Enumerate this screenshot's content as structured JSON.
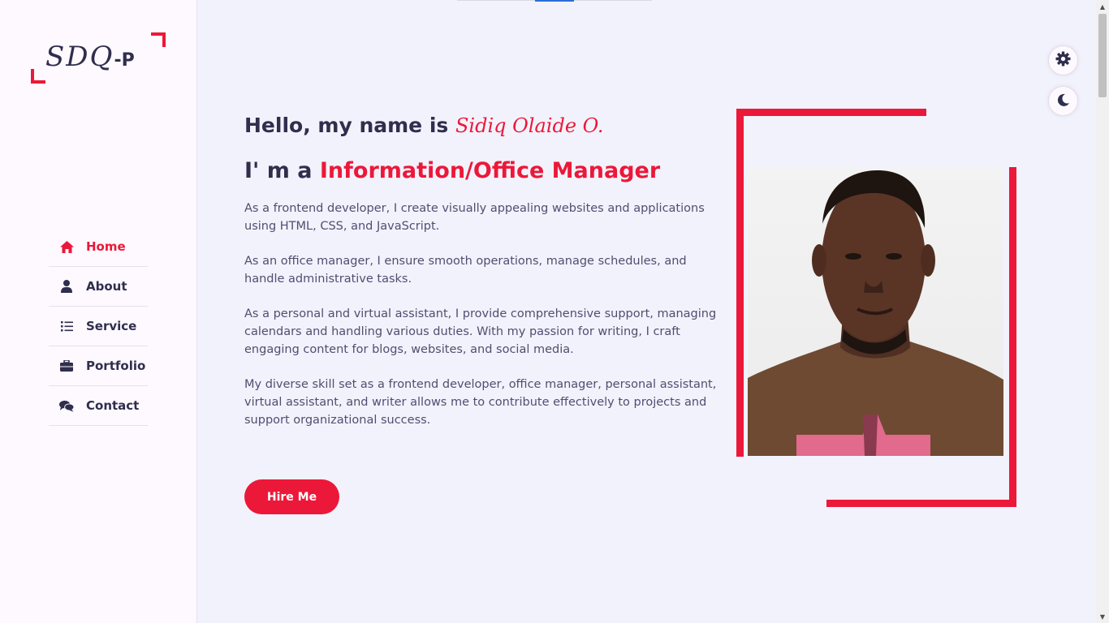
{
  "logo": {
    "text": "SDQ",
    "suffix": "-P"
  },
  "nav": {
    "items": [
      {
        "label": "Home",
        "icon": "home-icon",
        "active": true
      },
      {
        "label": "About",
        "icon": "user-icon"
      },
      {
        "label": "Service",
        "icon": "list-icon"
      },
      {
        "label": "Portfolio",
        "icon": "briefcase-icon"
      },
      {
        "label": "Contact",
        "icon": "comments-icon"
      }
    ]
  },
  "hero": {
    "greeting_prefix": "Hello, my name is ",
    "name": "Sidiq Olaide O.",
    "role_prefix": "I' m a ",
    "role": "Information/Office Manager",
    "bio": [
      "As a frontend developer, I create visually appealing websites and applications using HTML, CSS, and JavaScript.",
      "As an office manager, I ensure smooth operations, manage schedules, and handle administrative tasks.",
      "As a personal and virtual assistant, I provide comprehensive support, managing calendars and handling various duties. With my passion for writing, I craft engaging content for blogs, websites, and social media.",
      "My diverse skill set as a frontend developer, office manager, personal assistant, virtual assistant, and writer allows me to contribute effectively to projects and support organizational success."
    ],
    "hire_button": "Hire Me"
  },
  "colors": {
    "accent": "#ec1839",
    "text": "#302e4d",
    "background": "#f2f2fc",
    "sidebar": "#fdf9ff"
  },
  "controls": {
    "settings_icon": "gear-icon",
    "theme_icon": "moon-icon"
  }
}
